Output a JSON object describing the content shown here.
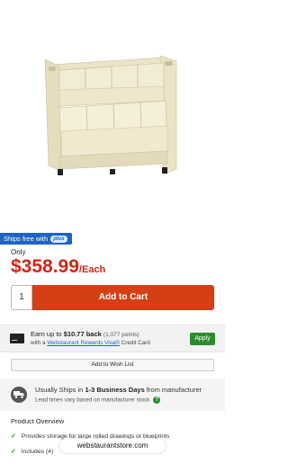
{
  "shipping_badge": {
    "text": "Ships free with",
    "plus": "plus"
  },
  "pricing": {
    "only_label": "Only",
    "price": "$358.99",
    "unit": "/Each"
  },
  "cart": {
    "quantity": "1",
    "add_label": "Add to Cart"
  },
  "rewards": {
    "earn_prefix": "Earn up to",
    "earn_amount": "$10.77 back",
    "earn_points": "(1,077 points)",
    "with_prefix": "with a",
    "card_link": "Webstaurant Rewards Visa®",
    "with_suffix": "Credit Card",
    "apply_label": "Apply"
  },
  "wishlist": {
    "label": "Add to Wish List"
  },
  "shipping": {
    "line1_prefix": "Usually Ships in",
    "line1_bold": "1-3 Business Days",
    "line1_suffix": "from manufacturer",
    "line2": "Lead times vary based on manufacturer stock",
    "help": "?"
  },
  "overview": {
    "title": "Product Overview",
    "bullets": [
      "Provides storage for large rolled drawings or blueprints",
      "Includes (4)"
    ]
  },
  "domain_badge": "webstaurantstore.com",
  "colors": {
    "price": "#d0261a",
    "cart_button": "#d43f16",
    "apply": "#2a8c2f",
    "badge": "#1e63c5"
  }
}
